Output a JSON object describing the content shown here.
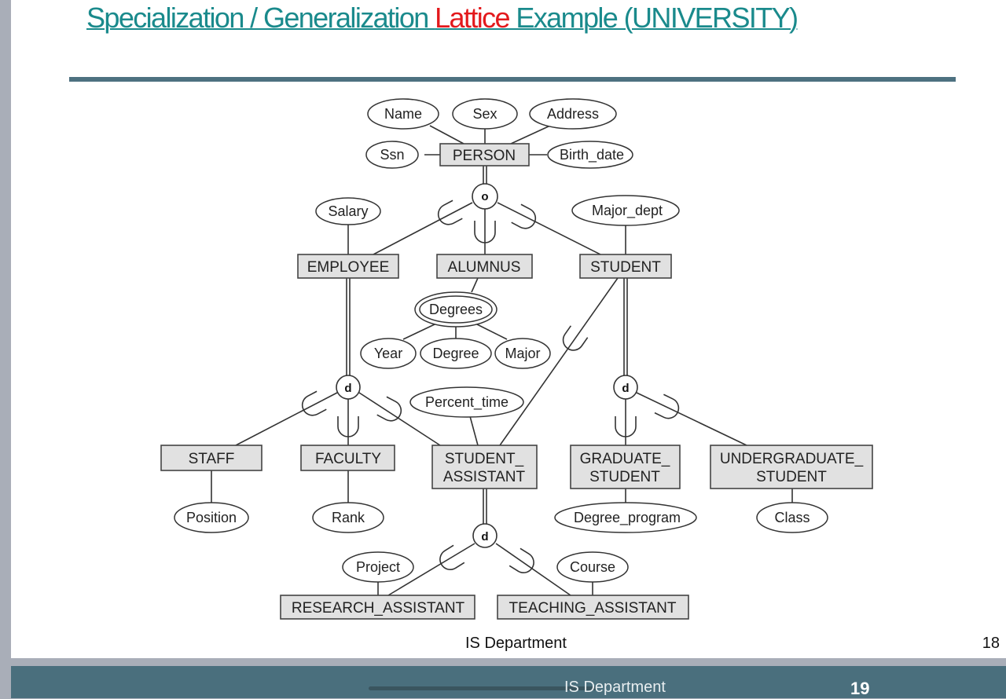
{
  "slide": {
    "title_parts": [
      "Specialization / Generalization ",
      "Lattice",
      " Example (UNIVERSITY)"
    ],
    "accent_color": "#1a8a8c",
    "highlight_color": "#e3191c",
    "footer": "IS Department",
    "page_number": "18"
  },
  "next_slide": {
    "footer": "IS Department",
    "page_number": "19"
  },
  "diagram": {
    "entities": {
      "person": "PERSON",
      "employee": "EMPLOYEE",
      "alumnus": "ALUMNUS",
      "student": "STUDENT",
      "staff": "STAFF",
      "faculty": "FACULTY",
      "student_assistant": [
        "STUDENT_",
        "ASSISTANT"
      ],
      "graduate_student": [
        "GRADUATE_",
        "STUDENT"
      ],
      "undergraduate_student": [
        "UNDERGRADUATE_",
        "STUDENT"
      ],
      "research_assistant": "RESEARCH_ASSISTANT",
      "teaching_assistant": "TEACHING_ASSISTANT"
    },
    "attributes": {
      "name": "Name",
      "sex": "Sex",
      "address": "Address",
      "ssn": "Ssn",
      "birth_date": "Birth_date",
      "salary": "Salary",
      "major_dept": "Major_dept",
      "degrees": "Degrees",
      "year": "Year",
      "degree": "Degree",
      "major": "Major",
      "percent_time": "Percent_time",
      "position": "Position",
      "rank": "Rank",
      "degree_program": "Degree_program",
      "class": "Class",
      "project": "Project",
      "course": "Course"
    },
    "constraints": {
      "person_overlap": "o",
      "employee_disjoint": "d",
      "student_disjoint": "d",
      "student_assistant_disjoint": "d"
    }
  }
}
